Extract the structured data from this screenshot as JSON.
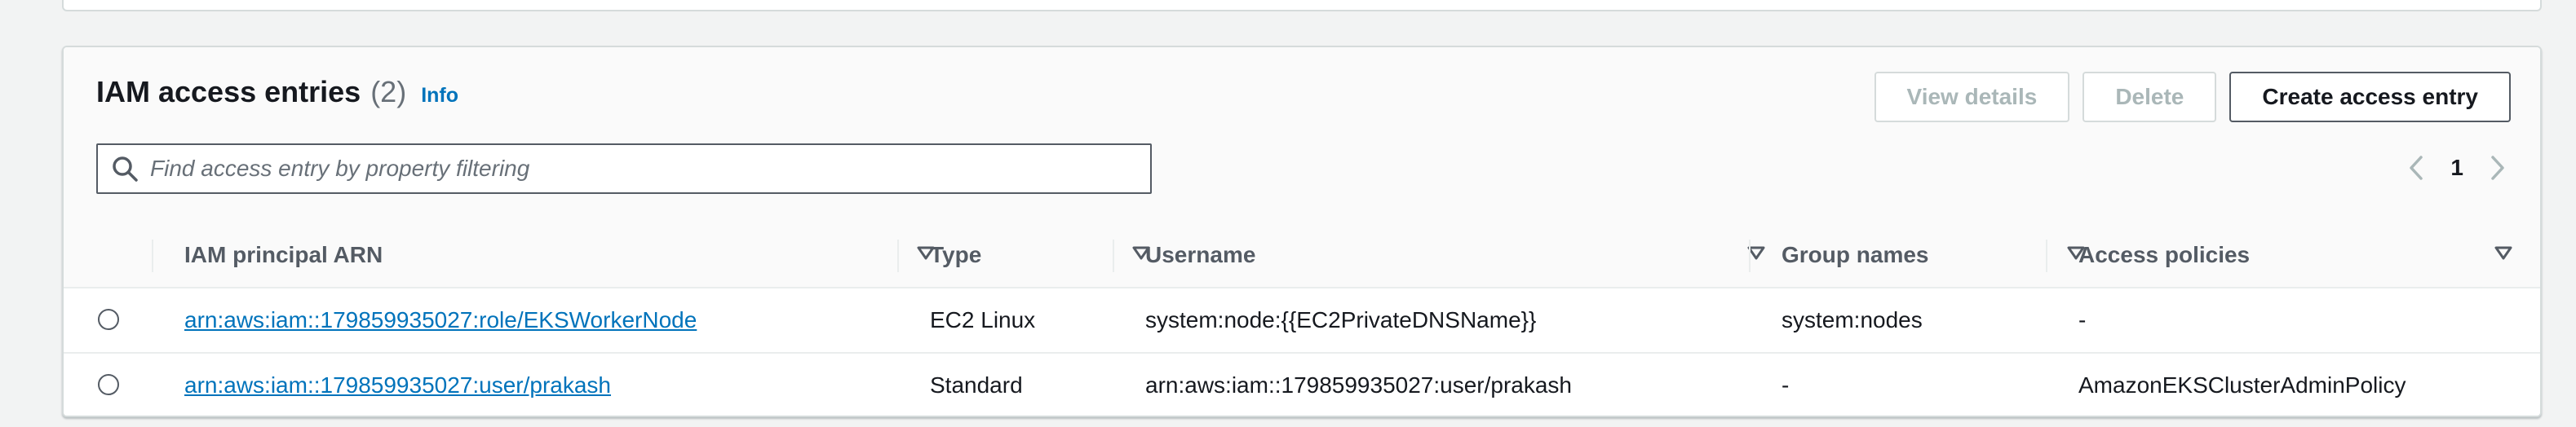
{
  "panel": {
    "title": "IAM access entries",
    "count": "(2)",
    "info_link": "Info"
  },
  "actions": {
    "view_details": "View details",
    "delete": "Delete",
    "create": "Create access entry"
  },
  "search": {
    "placeholder": "Find access entry by property filtering"
  },
  "pagination": {
    "current_page": "1"
  },
  "table": {
    "columns": [
      "IAM principal ARN",
      "Type",
      "Username",
      "Group names",
      "Access policies"
    ],
    "rows": [
      {
        "arn": "arn:aws:iam::179859935027:role/EKSWorkerNode",
        "type": "EC2 Linux",
        "username": "system:node:{{EC2PrivateDNSName}}",
        "group_names": "system:nodes",
        "access_policies": "-"
      },
      {
        "arn": "arn:aws:iam::179859935027:user/prakash",
        "type": "Standard",
        "username": "arn:aws:iam::179859935027:user/prakash",
        "group_names": "-",
        "access_policies": "AmazonEKSClusterAdminPolicy"
      }
    ]
  },
  "colors": {
    "link": "#0073bb",
    "header_bg": "#fafafa",
    "page_bg": "#f2f3f3",
    "border": "#d5dbdb"
  },
  "icons": {
    "search": "search-icon",
    "prev": "chevron-left-icon",
    "next": "chevron-right-icon",
    "sort": "sort-caret-down-icon"
  }
}
